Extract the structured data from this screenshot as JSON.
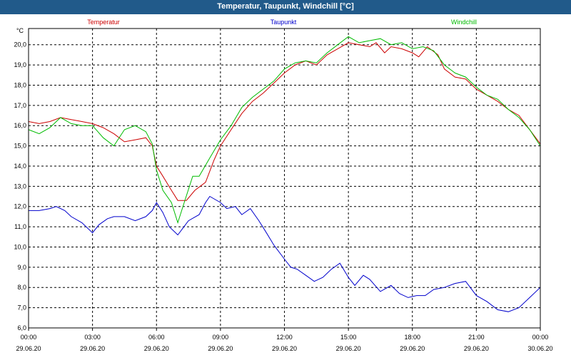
{
  "window": {
    "title": "Temperatur, Taupunkt, Windchill [°C]"
  },
  "colors": {
    "title_bar": "#215a8a",
    "temperatur": "#cc0000",
    "taupunkt": "#0000cc",
    "windchill": "#00bb00",
    "grid": "#000000"
  },
  "chart_data": {
    "type": "line",
    "title": "Temperatur, Taupunkt, Windchill [°C]",
    "ylabel": "°C",
    "ylim": [
      6.0,
      20.8
    ],
    "xlim": [
      0,
      24
    ],
    "grid": true,
    "legend_position": "top",
    "y_ticks": [
      "6,0",
      "7,0",
      "8,0",
      "9,0",
      "10,0",
      "11,0",
      "12,0",
      "13,0",
      "14,0",
      "15,0",
      "16,0",
      "17,0",
      "18,0",
      "19,0",
      "20,0"
    ],
    "x_ticks": [
      {
        "time": "00:00",
        "date": "29.06.20"
      },
      {
        "time": "03:00",
        "date": "29.06.20"
      },
      {
        "time": "06:00",
        "date": "29.06.20"
      },
      {
        "time": "09:00",
        "date": "29.06.20"
      },
      {
        "time": "12:00",
        "date": "29.06.20"
      },
      {
        "time": "15:00",
        "date": "29.06.20"
      },
      {
        "time": "18:00",
        "date": "29.06.20"
      },
      {
        "time": "21:00",
        "date": "29.06.20"
      },
      {
        "time": "00:00",
        "date": "30.06.20"
      }
    ],
    "series": [
      {
        "name": "Temperatur",
        "color": "#cc0000",
        "points": [
          [
            0,
            16.2
          ],
          [
            0.5,
            16.1
          ],
          [
            1.0,
            16.2
          ],
          [
            1.5,
            16.4
          ],
          [
            2.0,
            16.3
          ],
          [
            2.5,
            16.2
          ],
          [
            3.0,
            16.1
          ],
          [
            3.5,
            15.9
          ],
          [
            4.0,
            15.6
          ],
          [
            4.5,
            15.2
          ],
          [
            5.0,
            15.3
          ],
          [
            5.5,
            15.4
          ],
          [
            5.8,
            15.0
          ],
          [
            6.0,
            14.0
          ],
          [
            6.3,
            13.5
          ],
          [
            6.7,
            12.8
          ],
          [
            7.0,
            12.3
          ],
          [
            7.4,
            12.3
          ],
          [
            7.8,
            12.8
          ],
          [
            8.3,
            13.2
          ],
          [
            8.7,
            14.3
          ],
          [
            9.0,
            15.0
          ],
          [
            9.5,
            15.8
          ],
          [
            10.0,
            16.6
          ],
          [
            10.5,
            17.2
          ],
          [
            11.0,
            17.6
          ],
          [
            11.5,
            18.1
          ],
          [
            12.0,
            18.6
          ],
          [
            12.5,
            19.0
          ],
          [
            13.0,
            19.2
          ],
          [
            13.5,
            19.0
          ],
          [
            14.0,
            19.5
          ],
          [
            14.5,
            19.8
          ],
          [
            15.0,
            20.1
          ],
          [
            15.5,
            20.0
          ],
          [
            16.0,
            19.9
          ],
          [
            16.3,
            20.1
          ],
          [
            16.7,
            19.6
          ],
          [
            17.0,
            19.9
          ],
          [
            17.5,
            19.8
          ],
          [
            18.0,
            19.6
          ],
          [
            18.3,
            19.4
          ],
          [
            18.7,
            19.9
          ],
          [
            19.2,
            19.5
          ],
          [
            19.5,
            18.8
          ],
          [
            20.0,
            18.4
          ],
          [
            20.5,
            18.3
          ],
          [
            21.0,
            17.8
          ],
          [
            21.5,
            17.5
          ],
          [
            22.0,
            17.2
          ],
          [
            22.5,
            16.8
          ],
          [
            23.0,
            16.5
          ],
          [
            23.5,
            15.8
          ],
          [
            24.0,
            15.1
          ]
        ]
      },
      {
        "name": "Taupunkt",
        "color": "#0000cc",
        "points": [
          [
            0,
            11.8
          ],
          [
            0.5,
            11.8
          ],
          [
            1.0,
            11.9
          ],
          [
            1.3,
            12.0
          ],
          [
            1.7,
            11.8
          ],
          [
            2.0,
            11.5
          ],
          [
            2.5,
            11.2
          ],
          [
            3.0,
            10.7
          ],
          [
            3.3,
            11.1
          ],
          [
            3.7,
            11.4
          ],
          [
            4.0,
            11.5
          ],
          [
            4.5,
            11.5
          ],
          [
            5.0,
            11.3
          ],
          [
            5.5,
            11.5
          ],
          [
            5.8,
            11.8
          ],
          [
            6.0,
            12.2
          ],
          [
            6.3,
            11.7
          ],
          [
            6.6,
            11.0
          ],
          [
            7.0,
            10.6
          ],
          [
            7.5,
            11.3
          ],
          [
            8.0,
            11.6
          ],
          [
            8.3,
            12.2
          ],
          [
            8.5,
            12.5
          ],
          [
            9.0,
            12.2
          ],
          [
            9.3,
            11.9
          ],
          [
            9.7,
            12.0
          ],
          [
            10.0,
            11.6
          ],
          [
            10.4,
            11.9
          ],
          [
            10.8,
            11.3
          ],
          [
            11.1,
            10.8
          ],
          [
            11.5,
            10.1
          ],
          [
            12.0,
            9.4
          ],
          [
            12.3,
            9.0
          ],
          [
            12.6,
            8.9
          ],
          [
            13.0,
            8.6
          ],
          [
            13.4,
            8.3
          ],
          [
            13.8,
            8.5
          ],
          [
            14.2,
            8.9
          ],
          [
            14.6,
            9.2
          ],
          [
            15.0,
            8.5
          ],
          [
            15.3,
            8.1
          ],
          [
            15.7,
            8.6
          ],
          [
            16.0,
            8.4
          ],
          [
            16.5,
            7.8
          ],
          [
            17.0,
            8.1
          ],
          [
            17.4,
            7.7
          ],
          [
            17.8,
            7.5
          ],
          [
            18.2,
            7.6
          ],
          [
            18.6,
            7.6
          ],
          [
            19.0,
            7.9
          ],
          [
            19.5,
            8.0
          ],
          [
            20.0,
            8.2
          ],
          [
            20.5,
            8.3
          ],
          [
            21.0,
            7.6
          ],
          [
            21.5,
            7.3
          ],
          [
            22.0,
            6.9
          ],
          [
            22.5,
            6.8
          ],
          [
            23.0,
            7.0
          ],
          [
            23.5,
            7.5
          ],
          [
            24.0,
            8.0
          ]
        ]
      },
      {
        "name": "Windchill",
        "color": "#00bb00",
        "points": [
          [
            0,
            15.8
          ],
          [
            0.5,
            15.6
          ],
          [
            1.0,
            15.9
          ],
          [
            1.5,
            16.4
          ],
          [
            2.0,
            16.1
          ],
          [
            2.5,
            16.0
          ],
          [
            3.0,
            16.0
          ],
          [
            3.5,
            15.4
          ],
          [
            4.0,
            15.0
          ],
          [
            4.5,
            15.8
          ],
          [
            5.0,
            16.0
          ],
          [
            5.5,
            15.7
          ],
          [
            5.8,
            15.1
          ],
          [
            6.0,
            13.8
          ],
          [
            6.3,
            12.8
          ],
          [
            6.7,
            12.2
          ],
          [
            7.0,
            11.2
          ],
          [
            7.3,
            12.2
          ],
          [
            7.7,
            13.5
          ],
          [
            8.0,
            13.5
          ],
          [
            8.5,
            14.4
          ],
          [
            9.0,
            15.3
          ],
          [
            9.5,
            16.0
          ],
          [
            10.0,
            16.9
          ],
          [
            10.5,
            17.4
          ],
          [
            11.0,
            17.8
          ],
          [
            11.5,
            18.2
          ],
          [
            12.0,
            18.8
          ],
          [
            12.5,
            19.1
          ],
          [
            13.0,
            19.2
          ],
          [
            13.5,
            19.1
          ],
          [
            14.0,
            19.6
          ],
          [
            14.5,
            20.0
          ],
          [
            15.0,
            20.4
          ],
          [
            15.5,
            20.1
          ],
          [
            16.0,
            20.2
          ],
          [
            16.5,
            20.3
          ],
          [
            17.0,
            20.0
          ],
          [
            17.5,
            20.1
          ],
          [
            18.0,
            19.8
          ],
          [
            18.5,
            19.9
          ],
          [
            19.0,
            19.7
          ],
          [
            19.5,
            19.0
          ],
          [
            20.0,
            18.6
          ],
          [
            20.5,
            18.4
          ],
          [
            21.0,
            17.9
          ],
          [
            21.5,
            17.5
          ],
          [
            22.0,
            17.3
          ],
          [
            22.5,
            16.8
          ],
          [
            23.0,
            16.4
          ],
          [
            23.5,
            15.8
          ],
          [
            24.0,
            15.0
          ]
        ]
      }
    ]
  }
}
